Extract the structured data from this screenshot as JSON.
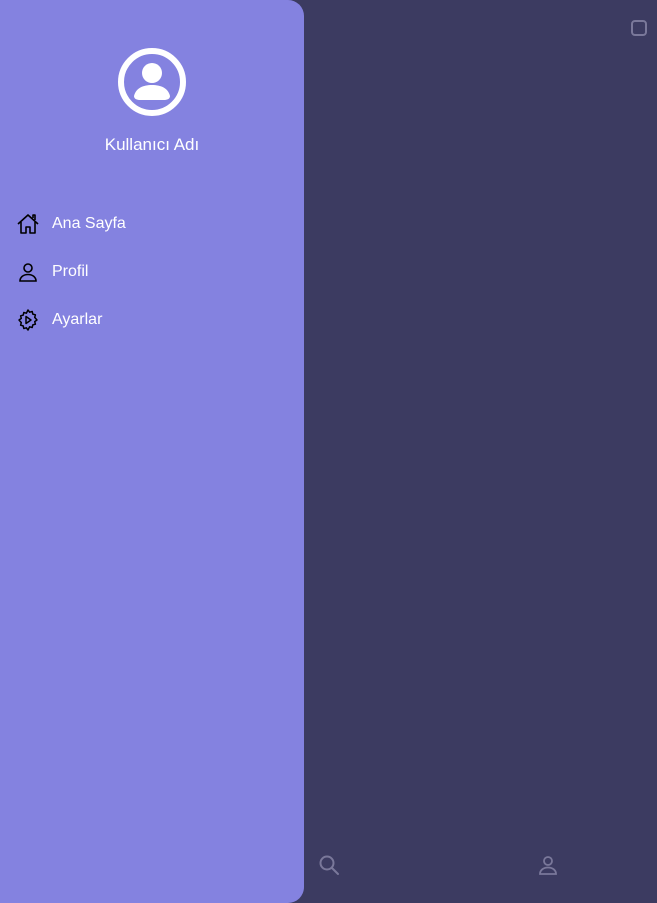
{
  "drawer": {
    "username": "Kullanıcı Adı",
    "items": [
      {
        "label": "Ana Sayfa",
        "icon": "home-icon"
      },
      {
        "label": "Profil",
        "icon": "person-icon"
      },
      {
        "label": "Ayarlar",
        "icon": "settings-icon"
      }
    ]
  },
  "bottom_nav": {
    "icons": [
      "search-icon",
      "person-icon"
    ]
  },
  "colors": {
    "background": "#3c3b61",
    "drawer": "#8482e0",
    "text": "#ffffff",
    "muted_icon": "#7a789a"
  }
}
